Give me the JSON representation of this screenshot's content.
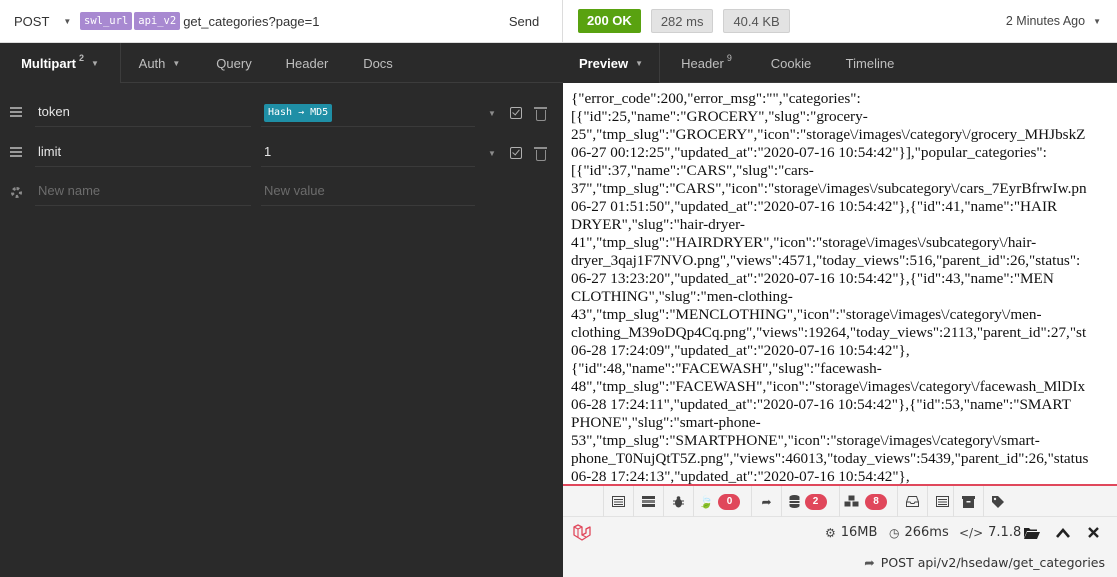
{
  "request": {
    "method": "POST",
    "url_chips": [
      "swl_url",
      "api_v2"
    ],
    "url_path": "get_categories?page=1",
    "send_label": "Send"
  },
  "request_tabs": [
    {
      "label": "Multipart",
      "badge": "2",
      "active": true
    },
    {
      "label": "Auth",
      "active": false
    },
    {
      "label": "Query",
      "active": false
    },
    {
      "label": "Header",
      "active": false
    },
    {
      "label": "Docs",
      "active": false
    }
  ],
  "params": [
    {
      "name": "token",
      "value_chip": "Hash → MD5"
    },
    {
      "name": "limit",
      "value": "1"
    }
  ],
  "new_param": {
    "name_placeholder": "New name",
    "value_placeholder": "New value"
  },
  "response": {
    "status": "200 OK",
    "time": "282 ms",
    "size": "40.4 KB",
    "time_ago": "2 Minutes Ago",
    "status_color": "#59a210"
  },
  "response_tabs": [
    {
      "label": "Preview",
      "active": true
    },
    {
      "label": "Header",
      "badge": "9",
      "active": false
    },
    {
      "label": "Cookie",
      "active": false
    },
    {
      "label": "Timeline",
      "active": false
    }
  ],
  "body_lines": [
    "{\"error_code\":200,\"error_msg\":\"\",\"categories\":",
    "[{\"id\":25,\"name\":\"GROCERY\",\"slug\":\"grocery-",
    "25\",\"tmp_slug\":\"GROCERY\",\"icon\":\"storage\\/images\\/category\\/grocery_MHJbskZ",
    "06-27 00:12:25\",\"updated_at\":\"2020-07-16 10:54:42\"}],\"popular_categories\":",
    "[{\"id\":37,\"name\":\"CARS\",\"slug\":\"cars-",
    "37\",\"tmp_slug\":\"CARS\",\"icon\":\"storage\\/images\\/subcategory\\/cars_7EyrBfrwIw.pn",
    "06-27 01:51:50\",\"updated_at\":\"2020-07-16 10:54:42\"},{\"id\":41,\"name\":\"HAIR",
    "DRYER\",\"slug\":\"hair-dryer-",
    "41\",\"tmp_slug\":\"HAIRDRYER\",\"icon\":\"storage\\/images\\/subcategory\\/hair-",
    "dryer_3qaj1F7NVO.png\",\"views\":4571,\"today_views\":516,\"parent_id\":26,\"status\":",
    "06-27 13:23:20\",\"updated_at\":\"2020-07-16 10:54:42\"},{\"id\":43,\"name\":\"MEN",
    "CLOTHING\",\"slug\":\"men-clothing-",
    "43\",\"tmp_slug\":\"MENCLOTHING\",\"icon\":\"storage\\/images\\/category\\/men-",
    "clothing_M39oDQp4Cq.png\",\"views\":19264,\"today_views\":2113,\"parent_id\":27,\"st",
    "06-28 17:24:09\",\"updated_at\":\"2020-07-16 10:54:42\"},",
    "{\"id\":48,\"name\":\"FACEWASH\",\"slug\":\"facewash-",
    "48\",\"tmp_slug\":\"FACEWASH\",\"icon\":\"storage\\/images\\/category\\/facewash_MlDIx",
    "06-28 17:24:11\",\"updated_at\":\"2020-07-16 10:54:42\"},{\"id\":53,\"name\":\"SMART",
    "PHONE\",\"slug\":\"smart-phone-",
    "53\",\"tmp_slug\":\"SMARTPHONE\",\"icon\":\"storage\\/images\\/category\\/smart-",
    "phone_T0NujQtT5Z.png\",\"views\":46013,\"today_views\":5439,\"parent_id\":26,\"status",
    "06-28 17:24:13\",\"updated_at\":\"2020-07-16 10:54:42\"},"
  ],
  "debugbar": {
    "accent": "#e0475b",
    "counts": {
      "logs": "0",
      "queries": "2",
      "models": "8"
    },
    "memory": "16MB",
    "duration": "266ms",
    "php_version": "7.1.8",
    "route": "POST api/v2/hsedaw/get_categories"
  }
}
